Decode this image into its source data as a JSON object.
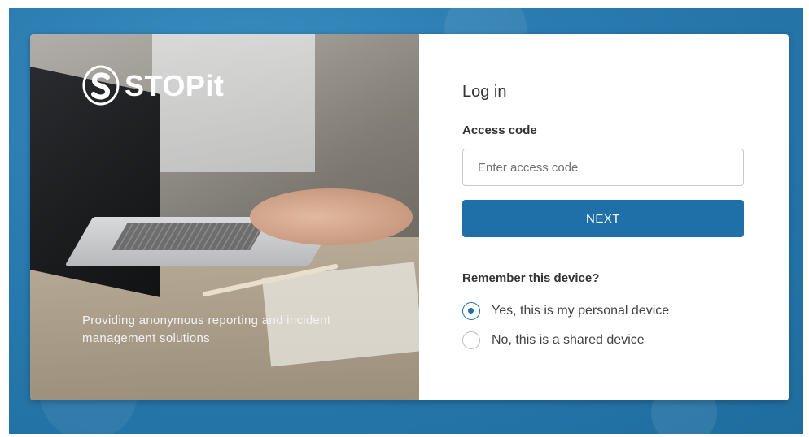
{
  "brand": {
    "name": "STOPit",
    "tagline": "Providing anonymous reporting and incident management solutions",
    "logo_icon": "stopit-s-logo-icon"
  },
  "login": {
    "title": "Log in",
    "access_code_label": "Access code",
    "access_code_placeholder": "Enter access code",
    "access_code_value": "",
    "next_label": "NEXT",
    "remember_label": "Remember this device?",
    "options": [
      {
        "label": "Yes, this is my personal device",
        "selected": true
      },
      {
        "label": "No, this is a shared device",
        "selected": false
      }
    ]
  },
  "colors": {
    "primary": "#1f6fa8",
    "background": "#2a7bb0",
    "text": "#333333"
  }
}
